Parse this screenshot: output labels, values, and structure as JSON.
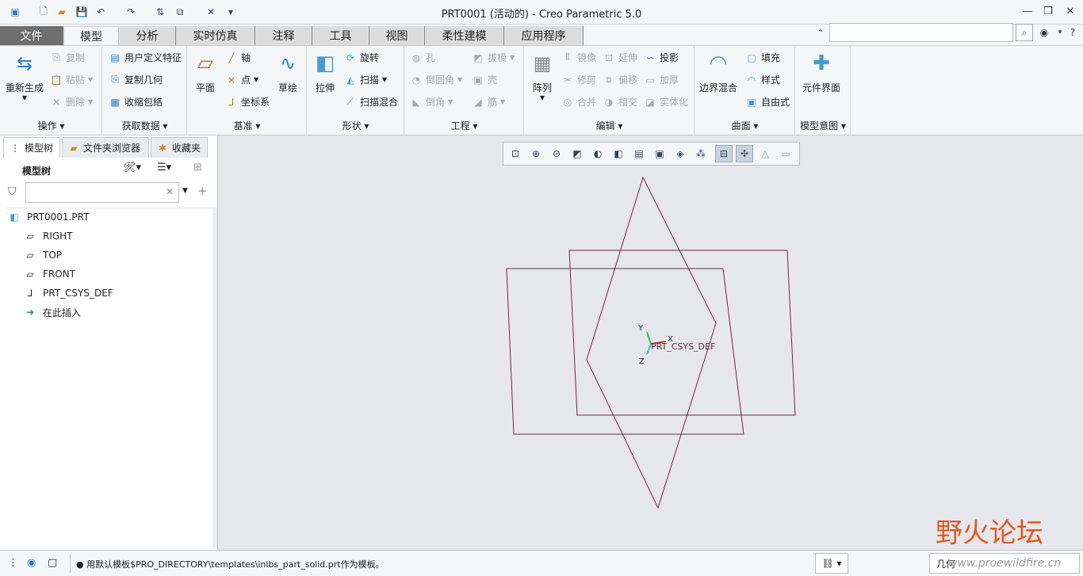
{
  "window": {
    "title": "PRT0001 (活动的) - Creo Parametric 5.0"
  },
  "tabs": [
    "文件",
    "模型",
    "分析",
    "实时仿真",
    "注释",
    "工具",
    "视图",
    "柔性建模",
    "应用程序"
  ],
  "ribbon": {
    "operations": {
      "label": "操作",
      "regen": "重新生成",
      "copy": "复制",
      "paste": "粘贴",
      "delete": "删除"
    },
    "get_data": {
      "label": "获取数据",
      "udf": "用户定义特征",
      "copy_geom": "复制几何",
      "shrinkwrap": "收缩包络"
    },
    "datum": {
      "label": "基准",
      "plane": "平面",
      "axis": "轴",
      "point": "点",
      "csys": "坐标系",
      "sketch": "草绘"
    },
    "shapes": {
      "label": "形状",
      "extrude": "拉伸",
      "revolve": "旋转",
      "sweep": "扫描",
      "swept_blend": "扫描混合"
    },
    "engineering": {
      "label": "工程",
      "hole": "孔",
      "draft": "拔模",
      "round": "倒圆角",
      "shell": "壳",
      "chamfer": "倒角",
      "rib": "筋"
    },
    "editing": {
      "label": "编辑",
      "pattern": "阵列",
      "mirror": "镜像",
      "extend": "延伸",
      "project": "投影",
      "trim": "修剪",
      "offset": "偏移",
      "thicken": "加厚",
      "merge": "合并",
      "intersect": "相交",
      "solidify": "实体化"
    },
    "surfaces": {
      "label": "曲面",
      "boundary": "边界混合",
      "fill": "填充",
      "style": "样式",
      "freestyle": "自由式"
    },
    "intent": {
      "label": "模型意图",
      "component": "元件界面"
    }
  },
  "left_tabs": [
    "模型树",
    "文件夹浏览器",
    "收藏夹"
  ],
  "tree": {
    "header": "模型树",
    "filter_placeholder": "",
    "items": [
      {
        "label": "PRT0001.PRT",
        "icon": "part-icon"
      },
      {
        "label": "RIGHT",
        "icon": "datum-plane-icon"
      },
      {
        "label": "TOP",
        "icon": "datum-plane-icon"
      },
      {
        "label": "FRONT",
        "icon": "datum-plane-icon"
      },
      {
        "label": "PRT_CSYS_DEF",
        "icon": "csys-icon"
      },
      {
        "label": "在此插入",
        "icon": "insert-arrow-icon"
      }
    ]
  },
  "graphics": {
    "csys_label": "PRT_CSYS_DEF",
    "x": "X",
    "y": "Y",
    "z": "Z",
    "plane_color": "#6e2a3c"
  },
  "status": {
    "message": "用默认模板$PRO_DIRECTORY\\templates\\inlbs_part_solid.prt作为模板。",
    "filter": "几何"
  },
  "watermark": {
    "title": "野火论坛",
    "url": "www.proewildfire.cn"
  }
}
